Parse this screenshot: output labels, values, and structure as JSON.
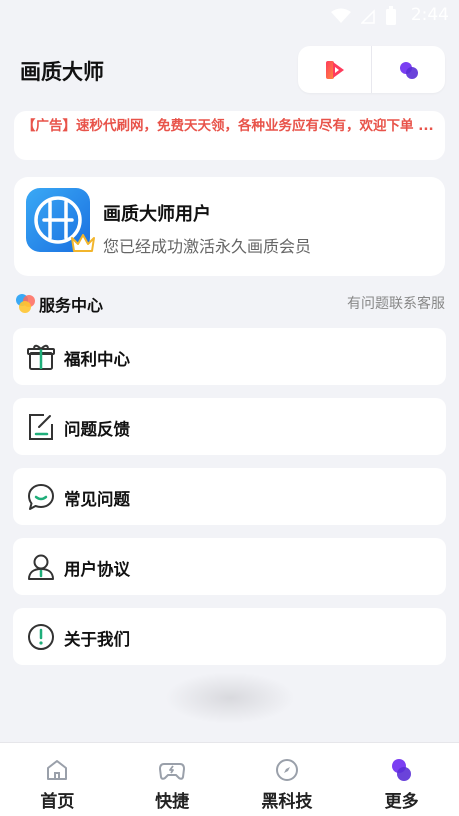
{
  "status_bar": {
    "time": "2:44"
  },
  "header": {
    "title": "画质大师"
  },
  "ad": {
    "text": "【广告】速秒代刷网，免费天天领，各种业务应有尽有，欢迎下单 ..."
  },
  "user": {
    "name": "画质大师用户",
    "desc": "您已经成功激活永久画质会员"
  },
  "service": {
    "title": "服务中心",
    "hint": "有问题联系客服"
  },
  "menu": [
    {
      "label": "福利中心",
      "icon": "gift-icon"
    },
    {
      "label": "问题反馈",
      "icon": "edit-icon"
    },
    {
      "label": "常见问题",
      "icon": "chat-icon"
    },
    {
      "label": "用户协议",
      "icon": "user-icon"
    },
    {
      "label": "关于我们",
      "icon": "info-icon"
    }
  ],
  "tabs": [
    {
      "label": "首页",
      "icon": "home-icon"
    },
    {
      "label": "快捷",
      "icon": "gamepad-icon"
    },
    {
      "label": "黑科技",
      "icon": "compass-icon"
    },
    {
      "label": "更多",
      "icon": "more-bubbles-icon"
    }
  ],
  "colors": {
    "accent": "#6a3df0",
    "ad_text": "#e8534a",
    "icon_green": "#1fae7a",
    "background": "#f2f3f7"
  }
}
